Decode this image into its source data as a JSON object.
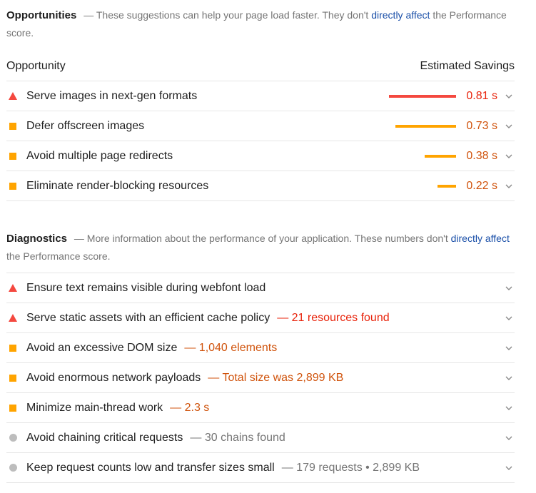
{
  "opportunities": {
    "title": "Opportunities",
    "desc_prefix": "— These suggestions can help your page load faster. They don't ",
    "desc_link": "directly affect",
    "desc_suffix": " the Performance score.",
    "column_left": "Opportunity",
    "column_right": "Estimated Savings",
    "max_savings": 0.81,
    "items": [
      {
        "icon": "fail-triangle-icon",
        "status": "fail",
        "title": "Serve images in next-gen formats",
        "savings": 0.81,
        "savings_label": "0.81 s"
      },
      {
        "icon": "average-square-icon",
        "status": "avg",
        "title": "Defer offscreen images",
        "savings": 0.73,
        "savings_label": "0.73 s"
      },
      {
        "icon": "average-square-icon",
        "status": "avg",
        "title": "Avoid multiple page redirects",
        "savings": 0.38,
        "savings_label": "0.38 s"
      },
      {
        "icon": "average-square-icon",
        "status": "avg",
        "title": "Eliminate render-blocking resources",
        "savings": 0.22,
        "savings_label": "0.22 s"
      }
    ]
  },
  "diagnostics": {
    "title": "Diagnostics",
    "desc_prefix": "— More information about the performance of your application. These numbers don't ",
    "desc_link": "directly affect",
    "desc_suffix": " the Performance score.",
    "items": [
      {
        "status": "fail",
        "title": "Ensure text remains visible during webfont load",
        "detail": ""
      },
      {
        "status": "fail",
        "title": "Serve static assets with an efficient cache policy",
        "detail": "— 21 resources found"
      },
      {
        "status": "avg",
        "title": "Avoid an excessive DOM size",
        "detail": "— 1,040 elements"
      },
      {
        "status": "avg",
        "title": "Avoid enormous network payloads",
        "detail": "— Total size was 2,899 KB"
      },
      {
        "status": "avg",
        "title": "Minimize main-thread work",
        "detail": "— 2.3 s"
      },
      {
        "status": "info",
        "title": "Avoid chaining critical requests",
        "detail": "— 30 chains found"
      },
      {
        "status": "info",
        "title": "Keep request counts low and transfer sizes small",
        "detail": "— 179 requests • 2,899 KB"
      }
    ]
  },
  "colors": {
    "fail": "#f4483f",
    "fail_text": "#e8240c",
    "average": "#ffa400",
    "average_text": "#d0530c",
    "info": "#bdbdbd",
    "link": "#1a4fa8"
  }
}
